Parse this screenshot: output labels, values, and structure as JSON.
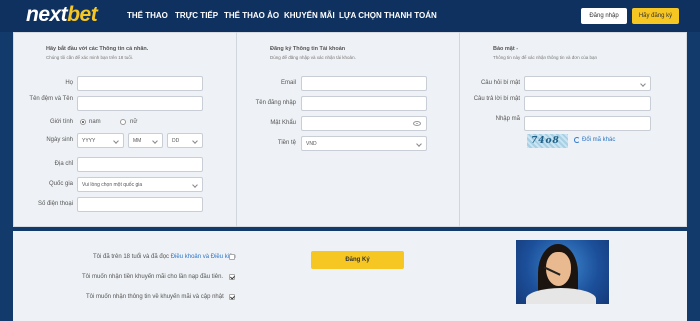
{
  "header": {
    "logo_part1": "next",
    "logo_part2": "bet",
    "nav": [
      "THỂ THAO",
      "TRỰC TIẾP",
      "THỂ THAO ẢO",
      "KHUYẾN MÃI",
      "LỰA CHỌN THANH TOÁN"
    ],
    "login_label": "Đăng nhập",
    "register_label": "Hãy đăng ký"
  },
  "personal": {
    "title": "Hãy bắt đầu với các Thông tin cá nhân.",
    "subtitle": "Chúng tôi cần để xác minh bạn trên 18 tuổi.",
    "labels": {
      "last_name": "Họ",
      "middle_first": "Tên đệm và Tên",
      "gender": "Giới tính",
      "dob": "Ngày sinh",
      "address": "Địa chỉ",
      "country": "Quốc gia",
      "phone": "Số điện thoại"
    },
    "gender_options": [
      "nam",
      "nữ"
    ],
    "dob": {
      "year": "YYYY",
      "month": "MM",
      "day": "DD"
    },
    "country_placeholder": "Vui lòng chọn một quốc gia"
  },
  "account": {
    "title": "Đăng ký Thông tin Tài khoản",
    "subtitle": "Dùng để đăng nhập và xác nhận tài khoản.",
    "labels": {
      "email": "Email",
      "username": "Tên đăng nhập",
      "password": "Mật Khẩu",
      "currency": "Tiền tệ"
    },
    "currency_value": "VND"
  },
  "security": {
    "title": "Bảo mật -",
    "subtitle": "Thông tin này để xác nhận thông tin và đơn của bạn",
    "labels": {
      "question": "Câu hỏi bí mật",
      "answer": "Câu trả lời bí mật",
      "code": "Nhập mã"
    },
    "captcha_text": "74o8",
    "refresh_label": "Đổi mã khác"
  },
  "bottom": {
    "agree_text": "Tôi đã trên 18 tuổi và đã đọc ",
    "agree_link": "Điều khoản và Điều kiện",
    "promo1": "Tôi muốn nhận tiền khuyến mãi cho lần nạp đầu tiên.",
    "promo2": "Tôi muốn nhận thông tin về khuyến mãi và cập nhật",
    "submit_label": "Đăng Ký"
  },
  "colors": {
    "header_bg": "#0f3160",
    "accent": "#f6c623",
    "link": "#2c76c8"
  }
}
